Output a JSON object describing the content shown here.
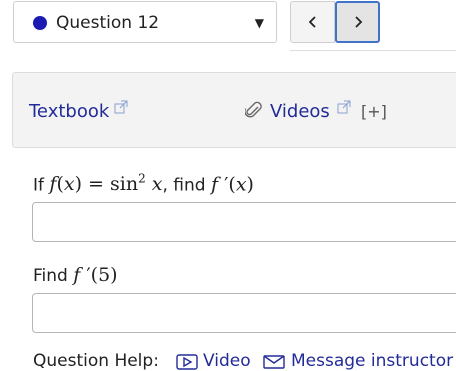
{
  "header": {
    "question_label": "Question 12"
  },
  "resources": {
    "textbook_label": "Textbook",
    "videos_label": "Videos",
    "expand_label": "[+]"
  },
  "question": {
    "intro_if": "If",
    "intro_find": ", find",
    "find_label": "Find",
    "eval_arg": "(5)"
  },
  "help": {
    "label": "Question Help:",
    "video_label": "Video",
    "message_label": "Message instructor"
  },
  "colors": {
    "accent_blue": "#1b1bb3",
    "link_color": "#232b98",
    "focus_border": "#3f74c9"
  }
}
